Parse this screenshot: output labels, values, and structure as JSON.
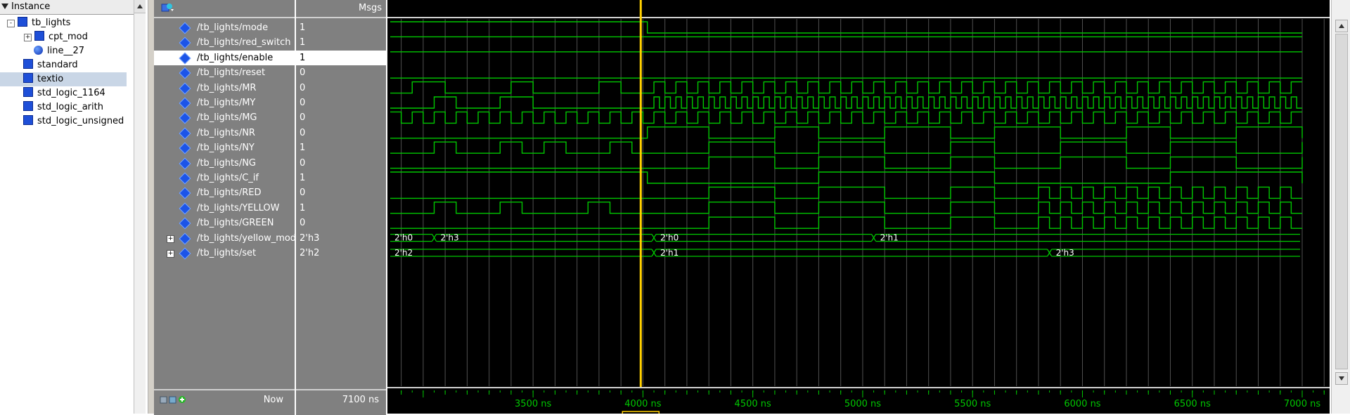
{
  "instance_panel": {
    "header_label": "Instance",
    "items": [
      {
        "label": "tb_lights",
        "icon": "module-square-icon",
        "expander": "-",
        "indent": 0
      },
      {
        "label": "cpt_mod",
        "icon": "module-square-icon",
        "expander": "+",
        "indent": 1
      },
      {
        "label": "line__27",
        "icon": "process-ball-icon",
        "expander": "",
        "indent": 1
      },
      {
        "label": "standard",
        "icon": "package-square-icon",
        "expander": "",
        "indent": 0
      },
      {
        "label": "textio",
        "icon": "package-square-icon",
        "expander": "",
        "indent": 0,
        "selected": true
      },
      {
        "label": "std_logic_1164",
        "icon": "package-square-icon",
        "expander": "",
        "indent": 0
      },
      {
        "label": "std_logic_arith",
        "icon": "package-square-icon",
        "expander": "",
        "indent": 0
      },
      {
        "label": "std_logic_unsigned",
        "icon": "package-square-icon",
        "expander": "",
        "indent": 0
      }
    ]
  },
  "wave_window": {
    "msgs_label": "Msgs",
    "now_label": "Now",
    "now_value": "7100 ns",
    "signals": [
      {
        "name": "/tb_lights/mode",
        "value": "1"
      },
      {
        "name": "/tb_lights/red_switch",
        "value": "1"
      },
      {
        "name": "/tb_lights/enable",
        "value": "1",
        "selected": true
      },
      {
        "name": "/tb_lights/reset",
        "value": "0"
      },
      {
        "name": "/tb_lights/MR",
        "value": "0"
      },
      {
        "name": "/tb_lights/MY",
        "value": "0"
      },
      {
        "name": "/tb_lights/MG",
        "value": "0"
      },
      {
        "name": "/tb_lights/NR",
        "value": "0"
      },
      {
        "name": "/tb_lights/NY",
        "value": "1"
      },
      {
        "name": "/tb_lights/NG",
        "value": "0"
      },
      {
        "name": "/tb_lights/C_if",
        "value": "1"
      },
      {
        "name": "/tb_lights/RED",
        "value": "0"
      },
      {
        "name": "/tb_lights/YELLOW",
        "value": "1"
      },
      {
        "name": "/tb_lights/GREEN",
        "value": "0"
      },
      {
        "name": "/tb_lights/yellow_mod",
        "value": "2'h3",
        "expandable": true
      },
      {
        "name": "/tb_lights/set",
        "value": "2'h2",
        "expandable": true
      }
    ],
    "bus_labels": {
      "yellow_mod": [
        "2'h0",
        "2'h3",
        "2'h0",
        "2'h1"
      ],
      "set": [
        "2'h2",
        "2'h1",
        "2'h3"
      ]
    },
    "ruler_labels": [
      "3500 ns",
      "4000 ns",
      "4500 ns",
      "5000 ns",
      "5500 ns",
      "6000 ns",
      "6500 ns",
      "7000 ns"
    ],
    "colors": {
      "wave": "#00c800",
      "cursor": "#ffd000",
      "background": "#000000"
    }
  }
}
